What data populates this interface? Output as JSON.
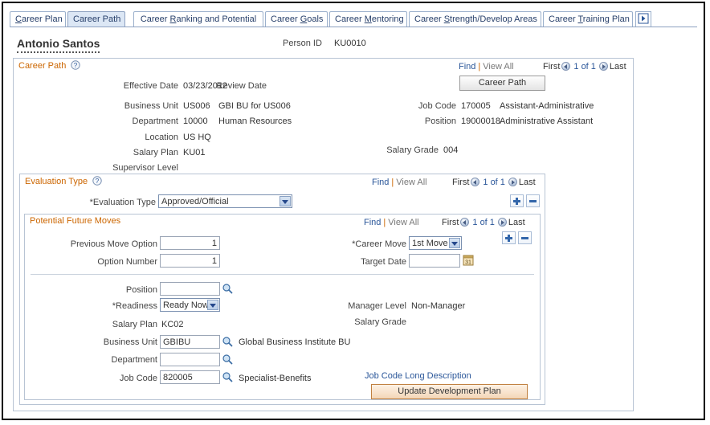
{
  "tabs": [
    {
      "label": "Career Plan",
      "accel": "C",
      "active": false
    },
    {
      "label": "Career Path",
      "accel": "",
      "active": true
    },
    {
      "label": "Career Ranking and Potential",
      "accel": "R",
      "active": false
    },
    {
      "label": "Career Goals",
      "accel": "G",
      "active": false
    },
    {
      "label": "Career Mentoring",
      "accel": "M",
      "active": false
    },
    {
      "label": "Career Strength/Develop Areas",
      "accel": "S",
      "active": false
    },
    {
      "label": "Career Training Plan",
      "accel": "T",
      "active": false
    }
  ],
  "tab_overflow_icon": "next-arrow-icon",
  "header": {
    "person_name": "Antonio Santos",
    "person_id_label": "Person ID",
    "person_id_value": "KU0010"
  },
  "career_path": {
    "group_title": "Career Path",
    "help_icon": "help-icon",
    "find_label": "Find",
    "separator": "|",
    "view_all_label": "View All",
    "first_label": "First",
    "count_label": "1 of 1",
    "last_label": "Last",
    "career_path_button": "Career Path",
    "fields": {
      "effective_date_label": "Effective Date",
      "effective_date_value": "03/23/2012",
      "review_date_label": "Review Date",
      "review_date_value": "",
      "business_unit_label": "Business Unit",
      "business_unit_value": "US006",
      "business_unit_desc": "GBI BU for US006",
      "department_label": "Department",
      "department_value": "10000",
      "department_desc": "Human Resources",
      "location_label": "Location",
      "location_value": "US HQ",
      "salary_plan_label": "Salary Plan",
      "salary_plan_value": "KU01",
      "supervisor_level_label": "Supervisor Level",
      "supervisor_level_value": "",
      "job_code_label": "Job Code",
      "job_code_value": "170005",
      "job_code_desc": "Assistant-Administrative",
      "position_label": "Position",
      "position_value": "19000018",
      "position_desc": "Administrative Assistant",
      "salary_grade_label": "Salary Grade",
      "salary_grade_value": "004"
    }
  },
  "evaluation_type": {
    "group_title": "Evaluation Type",
    "help_icon": "help-icon",
    "find_label": "Find",
    "separator": "|",
    "view_all_label": "View All",
    "first_label": "First",
    "count_label": "1 of 1",
    "last_label": "Last",
    "field_label": "*Evaluation Type",
    "field_value": "Approved/Official",
    "add_row_icon": "plus-icon",
    "delete_row_icon": "minus-icon"
  },
  "potential_future_moves": {
    "group_title": "Potential Future Moves",
    "find_label": "Find",
    "separator": "|",
    "view_all_label": "View All",
    "first_label": "First",
    "count_label": "1 of 1",
    "last_label": "Last",
    "add_row_icon": "plus-icon",
    "delete_row_icon": "minus-icon",
    "previous_move_option_label": "Previous Move Option",
    "previous_move_option_value": "1",
    "option_number_label": "Option Number",
    "option_number_value": "1",
    "career_move_label": "*Career Move",
    "career_move_value": "1st Move",
    "target_date_label": "Target Date",
    "target_date_value": "",
    "target_date_icon": "calendar-icon",
    "position_label": "Position",
    "position_value": "",
    "position_lookup_icon": "magnifier-icon",
    "readiness_label": "*Readiness",
    "readiness_value": "Ready Now",
    "manager_level_label": "Manager Level",
    "manager_level_value": "Non-Manager",
    "salary_plan_label": "Salary Plan",
    "salary_plan_value": "KC02",
    "salary_grade_label": "Salary Grade",
    "salary_grade_value": "",
    "business_unit_label": "Business Unit",
    "business_unit_value": "GBIBU",
    "business_unit_desc": "Global Business Institute BU",
    "business_unit_lookup_icon": "magnifier-icon",
    "department_label": "Department",
    "department_value": "",
    "department_lookup_icon": "magnifier-icon",
    "job_code_label": "Job Code",
    "job_code_value": "820005",
    "job_code_desc": "Specialist-Benefits",
    "job_code_lookup_icon": "magnifier-icon",
    "job_code_long_description_link": "Job Code Long Description",
    "update_development_plan_button": "Update Development Plan"
  },
  "colors": {
    "group_title": "#cc6600",
    "link": "#2a5699",
    "tab_active_bg": "#dce7f5",
    "button_orange_border": "#c08040",
    "frame_border": "#000000"
  }
}
